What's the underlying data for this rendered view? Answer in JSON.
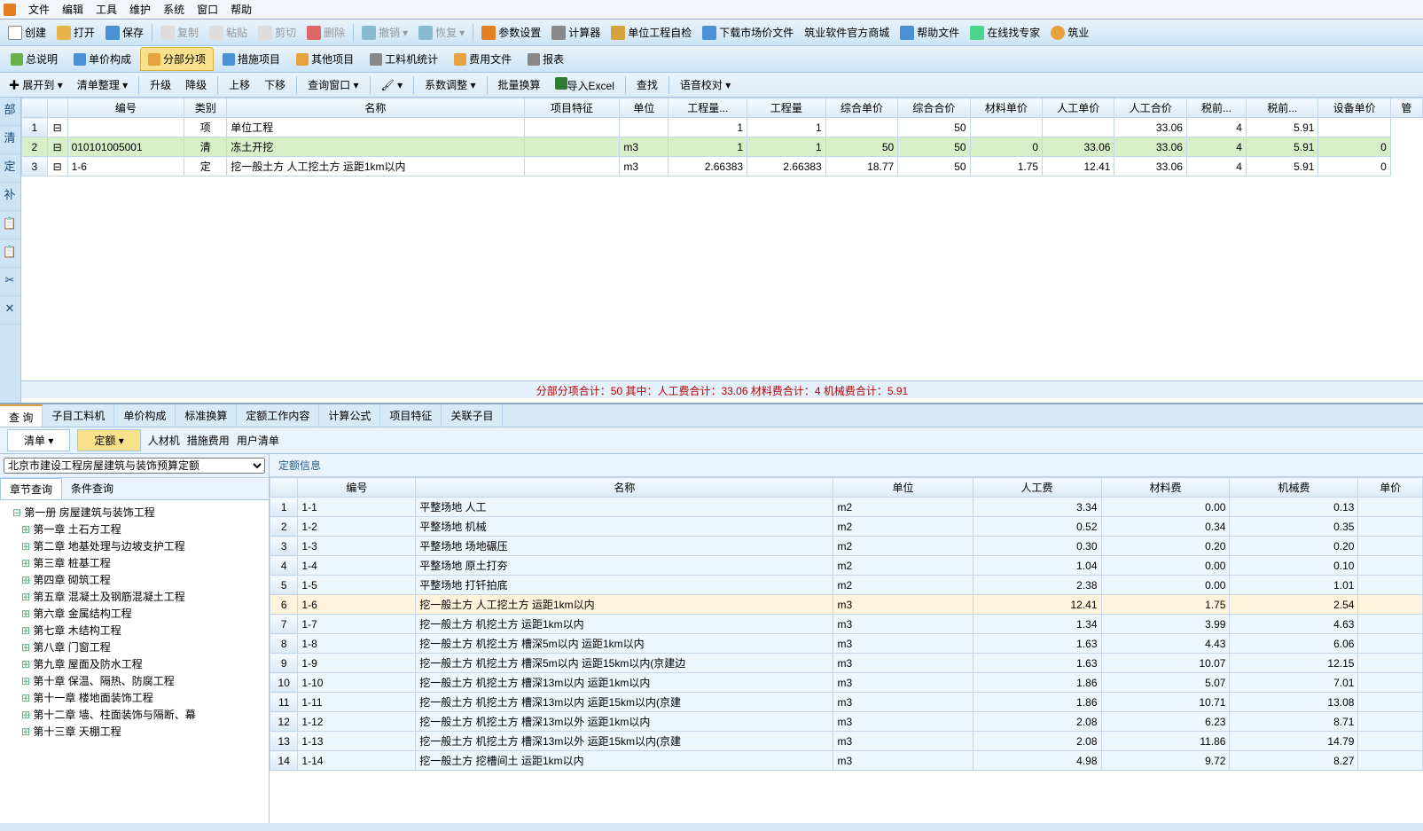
{
  "menu": {
    "items": [
      "文件",
      "编辑",
      "工具",
      "维护",
      "系统",
      "窗口",
      "帮助"
    ]
  },
  "toolbar1": {
    "create": "创建",
    "open": "打开",
    "save": "保存",
    "copy": "复制",
    "paste": "粘贴",
    "cut": "剪切",
    "delete": "删除",
    "undo": "撤销",
    "redo": "恢复",
    "param": "参数设置",
    "calc": "计算器",
    "unitcheck": "单位工程自检",
    "download": "下载市场价文件",
    "mall": "筑业软件官方商城",
    "help": "帮助文件",
    "online": "在线找专家",
    "zhu": "筑业"
  },
  "maintabs": {
    "general": "总说明",
    "danjia": "单价构成",
    "fenbu": "分部分项",
    "cuoshi": "措施项目",
    "qita": "其他项目",
    "gongliao": "工料机统计",
    "feiyong": "费用文件",
    "baobiao": "报表"
  },
  "subtool": {
    "expand": "展开到",
    "listfix": "清单整理",
    "up": "升级",
    "down": "降级",
    "moveup": "上移",
    "movedown": "下移",
    "query": "查询窗口",
    "coef": "系数调整",
    "batch": "批量换算",
    "excel": "导入Excel",
    "find": "查找",
    "voice": "语音校对"
  },
  "gridHeaders": [
    "编号",
    "类别",
    "名称",
    "项目特征",
    "单位",
    "工程量...",
    "工程量",
    "综合单价",
    "综合合价",
    "材料单价",
    "人工单价",
    "人工合价",
    "税前...",
    "税前...",
    "设备单价",
    "管"
  ],
  "gridRows": [
    {
      "num": "1",
      "code": "",
      "type": "项",
      "name": "单位工程",
      "feat": "",
      "unit": "",
      "q1": "1",
      "q2": "1",
      "p1": "",
      "p2": "50",
      "mat": "",
      "lab": "",
      "labtot": "33.06",
      "tax1": "4",
      "tax2": "5.91",
      "dev": ""
    },
    {
      "num": "2",
      "code": "010101005001",
      "type": "清",
      "name": "冻土开挖",
      "feat": "",
      "unit": "m3",
      "q1": "1",
      "q2": "1",
      "p1": "50",
      "p2": "50",
      "mat": "0",
      "lab": "33.06",
      "labtot": "33.06",
      "tax1": "4",
      "tax2": "5.91",
      "dev": "0",
      "green": true
    },
    {
      "num": "3",
      "code": "1-6",
      "type": "定",
      "name": "挖一般土方  人工挖土方  运距1km以内",
      "feat": "",
      "unit": "m3",
      "q1": "2.66383",
      "q2": "2.66383",
      "p1": "18.77",
      "p2": "50",
      "mat": "1.75",
      "lab": "12.41",
      "labtot": "33.06",
      "tax1": "4",
      "tax2": "5.91",
      "dev": "0"
    }
  ],
  "leftStrip": [
    "部",
    "清",
    "定",
    "补",
    "📋",
    "📋",
    "✂",
    "✕"
  ],
  "summary": "分部分项合计：50    其中：人工费合计：33.06    材料费合计：4    机械费合计：5.91",
  "detailTabs": [
    "查 询",
    "子目工料机",
    "单价构成",
    "标准换算",
    "定额工作内容",
    "计算公式",
    "项目特征",
    "关联子目"
  ],
  "filter": {
    "list": "清单",
    "quota": "定额",
    "rcj": "人材机",
    "cuoshi": "措施费用",
    "user": "用户清单"
  },
  "treeCombo": "北京市建设工程房屋建筑与装饰预算定额",
  "treeTabs": {
    "chap": "章节查询",
    "cond": "条件查询"
  },
  "tree": [
    {
      "t": "第一册 房屋建筑与装饰工程",
      "lv": 0,
      "open": true
    },
    {
      "t": "第一章  土石方工程",
      "lv": 1
    },
    {
      "t": "第二章  地基处理与边坡支护工程",
      "lv": 1
    },
    {
      "t": "第三章  桩基工程",
      "lv": 1
    },
    {
      "t": "第四章  砌筑工程",
      "lv": 1
    },
    {
      "t": "第五章  混凝土及钢筋混凝土工程",
      "lv": 1
    },
    {
      "t": "第六章  金属结构工程",
      "lv": 1
    },
    {
      "t": "第七章  木结构工程",
      "lv": 1
    },
    {
      "t": "第八章  门窗工程",
      "lv": 1
    },
    {
      "t": "第九章  屋面及防水工程",
      "lv": 1
    },
    {
      "t": "第十章  保温、隔热、防腐工程",
      "lv": 1
    },
    {
      "t": "第十一章  楼地面装饰工程",
      "lv": 1
    },
    {
      "t": "第十二章  墙、柱面装饰与隔断、幕",
      "lv": 1
    },
    {
      "t": "第十三章  天棚工程",
      "lv": 1
    }
  ],
  "detailTitle": "定额信息",
  "detailHeaders": [
    "编号",
    "名称",
    "单位",
    "人工费",
    "材料费",
    "机械费",
    "单价"
  ],
  "detailRows": [
    {
      "n": "1",
      "c": "1-1",
      "name": "平整场地  人工",
      "u": "m2",
      "lab": "3.34",
      "mat": "0.00",
      "mach": "0.13"
    },
    {
      "n": "2",
      "c": "1-2",
      "name": "平整场地  机械",
      "u": "m2",
      "lab": "0.52",
      "mat": "0.34",
      "mach": "0.35"
    },
    {
      "n": "3",
      "c": "1-3",
      "name": "平整场地  场地碾压",
      "u": "m2",
      "lab": "0.30",
      "mat": "0.20",
      "mach": "0.20"
    },
    {
      "n": "4",
      "c": "1-4",
      "name": "平整场地  原土打夯",
      "u": "m2",
      "lab": "1.04",
      "mat": "0.00",
      "mach": "0.10"
    },
    {
      "n": "5",
      "c": "1-5",
      "name": "平整场地  打钎拍底",
      "u": "m2",
      "lab": "2.38",
      "mat": "0.00",
      "mach": "1.01"
    },
    {
      "n": "6",
      "c": "1-6",
      "name": "挖一般土方  人工挖土方  运距1km以内",
      "u": "m3",
      "lab": "12.41",
      "mat": "1.75",
      "mach": "2.54",
      "sel": true
    },
    {
      "n": "7",
      "c": "1-7",
      "name": "挖一般土方  机挖土方  运距1km以内",
      "u": "m3",
      "lab": "1.34",
      "mat": "3.99",
      "mach": "4.63"
    },
    {
      "n": "8",
      "c": "1-8",
      "name": "挖一般土方  机挖土方  槽深5m以内 运距1km以内",
      "u": "m3",
      "lab": "1.63",
      "mat": "4.43",
      "mach": "6.06"
    },
    {
      "n": "9",
      "c": "1-9",
      "name": "挖一般土方  机挖土方  槽深5m以内 运距15km以内(京建边",
      "u": "m3",
      "lab": "1.63",
      "mat": "10.07",
      "mach": "12.15"
    },
    {
      "n": "10",
      "c": "1-10",
      "name": "挖一般土方  机挖土方  槽深13m以内 运距1km以内",
      "u": "m3",
      "lab": "1.86",
      "mat": "5.07",
      "mach": "7.01"
    },
    {
      "n": "11",
      "c": "1-11",
      "name": "挖一般土方  机挖土方  槽深13m以内 运距15km以内(京建",
      "u": "m3",
      "lab": "1.86",
      "mat": "10.71",
      "mach": "13.08"
    },
    {
      "n": "12",
      "c": "1-12",
      "name": "挖一般土方  机挖土方  槽深13m以外 运距1km以内",
      "u": "m3",
      "lab": "2.08",
      "mat": "6.23",
      "mach": "8.71"
    },
    {
      "n": "13",
      "c": "1-13",
      "name": "挖一般土方  机挖土方  槽深13m以外 运距15km以内(京建",
      "u": "m3",
      "lab": "2.08",
      "mat": "11.86",
      "mach": "14.79"
    },
    {
      "n": "14",
      "c": "1-14",
      "name": "挖一般土方  挖槽间土  运距1km以内",
      "u": "m3",
      "lab": "4.98",
      "mat": "9.72",
      "mach": "8.27"
    }
  ]
}
